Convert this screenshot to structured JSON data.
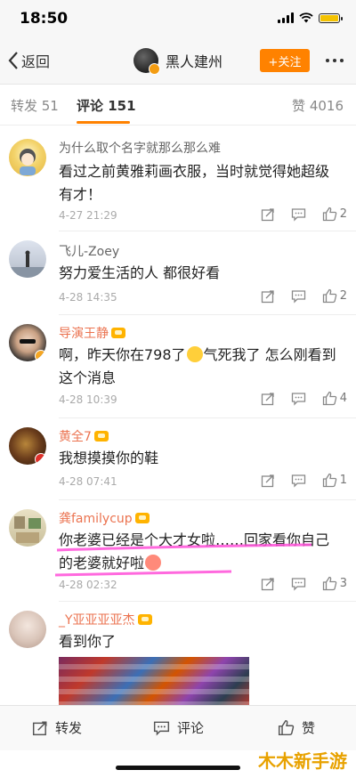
{
  "status": {
    "time": "18:50"
  },
  "nav": {
    "back_label": "返回",
    "title": "黑人建州",
    "follow_label": "+关注"
  },
  "tabs": {
    "repost": "转发 51",
    "comment": "评论 151",
    "likes": "赞 4016"
  },
  "comments": [
    {
      "username": "为什么取个名字就那么那么难",
      "text": "看过之前黄雅莉画衣服，当时就觉得她超级有才！",
      "time": "4-27 21:29",
      "likes": "2"
    },
    {
      "username": "飞儿-Zoey",
      "text": "努力爱生活的人 都很好看",
      "time": "4-28 14:35",
      "likes": "2"
    },
    {
      "username": "导演王静",
      "text_a": "啊，昨天你在798了",
      "text_b": "气死我了 怎么刚看到这个消息",
      "time": "4-28 10:39",
      "likes": "4"
    },
    {
      "username": "黄全7",
      "text": "我想摸摸你的鞋",
      "time": "4-28 07:41",
      "likes": "1"
    },
    {
      "username": "龚familycup",
      "text": "你老婆已经是个大才女啦……回家看你自己的老婆就好啦",
      "time": "4-28 02:32",
      "likes": "3"
    },
    {
      "username": "_Y亚亚亚亚杰",
      "text": "看到你了"
    }
  ],
  "bottom": {
    "repost": "转发",
    "comment": "评论",
    "like": "赞"
  },
  "watermark": "木木新手游",
  "colors": {
    "accent": "#ff8200",
    "vip_name": "#eb7350",
    "highlight": "#ff4fd8"
  }
}
